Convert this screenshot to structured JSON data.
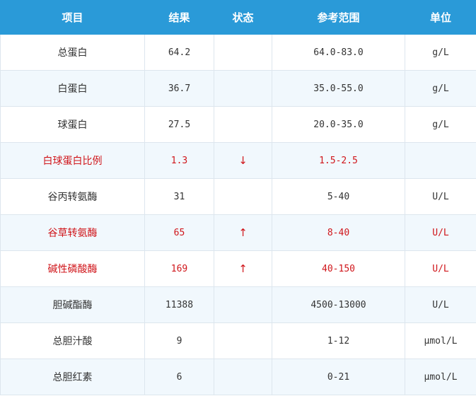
{
  "table": {
    "headers": [
      "项目",
      "结果",
      "状态",
      "参考范围",
      "单位"
    ],
    "rows": [
      {
        "item": "总蛋白",
        "result": "64.2",
        "status": "",
        "range": "64.0-83.0",
        "unit": "g/L",
        "abnormal": false
      },
      {
        "item": "白蛋白",
        "result": "36.7",
        "status": "",
        "range": "35.0-55.0",
        "unit": "g/L",
        "abnormal": false
      },
      {
        "item": "球蛋白",
        "result": "27.5",
        "status": "",
        "range": "20.0-35.0",
        "unit": "g/L",
        "abnormal": false
      },
      {
        "item": "白球蛋白比例",
        "result": "1.3",
        "status": "↓",
        "range": "1.5-2.5",
        "unit": "",
        "abnormal": true
      },
      {
        "item": "谷丙转氨酶",
        "result": "31",
        "status": "",
        "range": "5-40",
        "unit": "U/L",
        "abnormal": false
      },
      {
        "item": "谷草转氨酶",
        "result": "65",
        "status": "↑",
        "range": "8-40",
        "unit": "U/L",
        "abnormal": true
      },
      {
        "item": "碱性磷酸酶",
        "result": "169",
        "status": "↑",
        "range": "40-150",
        "unit": "U/L",
        "abnormal": true
      },
      {
        "item": "胆碱酯酶",
        "result": "11388",
        "status": "",
        "range": "4500-13000",
        "unit": "U/L",
        "abnormal": false
      },
      {
        "item": "总胆汁酸",
        "result": "9",
        "status": "",
        "range": "1-12",
        "unit": "μmol/L",
        "abnormal": false
      },
      {
        "item": "总胆红素",
        "result": "6",
        "status": "",
        "range": "0-21",
        "unit": "μmol/L",
        "abnormal": false
      }
    ]
  },
  "colors": {
    "header_bg": "#2a9ad8",
    "header_text": "#ffffff",
    "abnormal_text": "#d0161b",
    "stripe_bg": "#f1f8fd"
  }
}
